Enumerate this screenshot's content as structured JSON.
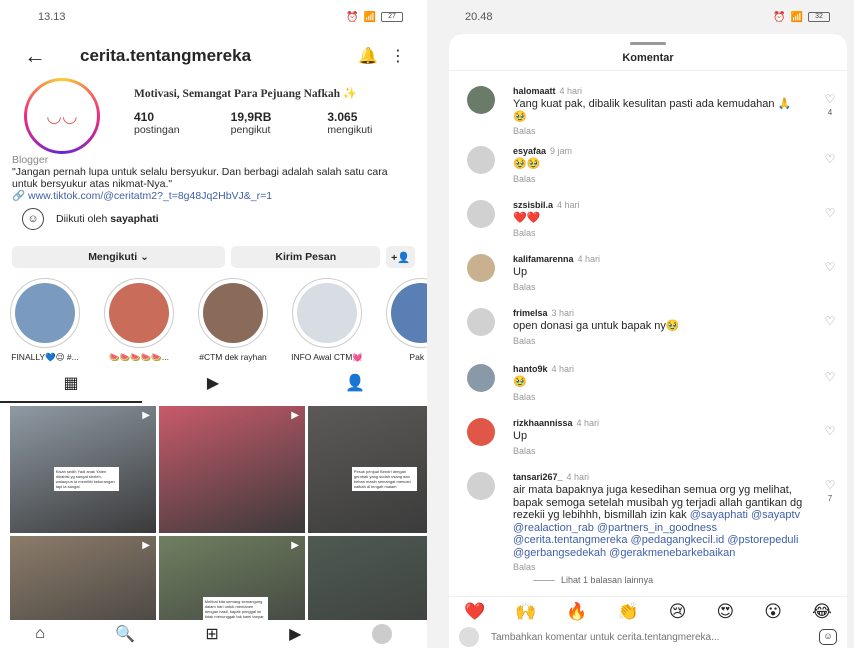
{
  "left": {
    "status": {
      "time": "13.13",
      "battery": "27"
    },
    "header": {
      "username": "cerita.tentangmereka",
      "back_icon": "arrow-left-icon",
      "notify_icon": "bell-icon",
      "menu_icon": "more-vertical-icon"
    },
    "profile": {
      "display_name": "Motivasi, Semangat Para Pejuang Nafkah ✨",
      "stats": [
        {
          "num": "410",
          "label": "postingan"
        },
        {
          "num": "19,9RB",
          "label": "pengikut"
        },
        {
          "num": "3.065",
          "label": "mengikuti"
        }
      ],
      "category": "Blogger",
      "bio": "\"Jangan pernah lupa untuk selalu bersyukur. Dan berbagi adalah salah satu cara untuk bersyukur atas nikmat-Nya.\"",
      "link": "www.tiktok.com/@ceritatm2?_t=8g48Jq2HbVJ&_r=1",
      "followed_by_prefix": "Diikuti oleh ",
      "followed_by_user": "sayaphati"
    },
    "buttons": {
      "following": "Mengikuti ⌄",
      "message": "Kirim Pesan",
      "add_person": "+👤"
    },
    "highlights": [
      {
        "label": "FINALLY💙😉 #...",
        "color": "#7a9bbf"
      },
      {
        "label": "🍉🍉🍉🍉🍉...",
        "color": "#c96d5a"
      },
      {
        "label": "#CTM dek rayhan",
        "color": "#8a6a58"
      },
      {
        "label": "INFO Awal CTM💓",
        "color": "#d8dde4"
      },
      {
        "label": "Pak D",
        "color": "#5a7fb5"
      }
    ],
    "photos": [
      {
        "color": "#8f9aa4",
        "caption": "Kisah sedih Yadi anak Yatim dihabisi yg sangat sholeh, walaupun ia memiliki kekurangan tapi ia sangat"
      },
      {
        "color": "#c85a6a",
        "caption": ""
      },
      {
        "color": "#5c5a58",
        "caption": "Pesuk penjual Bendri dengan gerobak yang sudah usang dan beban masih semangat mencari nafkah di tengah malam"
      },
      {
        "color": "#8c7c6a",
        "caption": ""
      },
      {
        "color": "#6f8060",
        "caption": "Melihat kita semang semangung dalam hari untuk memanen dengan hasil, bapak penggal ini tidak menunggak tak kami tanyar, apa kami semua bersemangat"
      },
      {
        "color": "#4e5a52",
        "caption": ""
      }
    ]
  },
  "right": {
    "status": {
      "time": "20.48",
      "battery": "32"
    },
    "sheet_title": "Komentar",
    "comments": [
      {
        "user": "halomaatt",
        "time": "4 hari",
        "text": "Yang kuat pak, dibalik kesulitan pasti ada kemudahan 🙏🥹",
        "likes": "4",
        "avatar": "#6a7b6a",
        "mentions": ""
      },
      {
        "user": "esyafaa",
        "time": "9 jam",
        "text": "🥹🥹",
        "likes": "",
        "avatar": "#d1d1d1",
        "mentions": ""
      },
      {
        "user": "szsisbil.a",
        "time": "4 hari",
        "text": "❤️❤️",
        "likes": "",
        "avatar": "#d1d1d1",
        "mentions": ""
      },
      {
        "user": "kalifamarenna",
        "time": "4 hari",
        "text": "Up",
        "likes": "",
        "avatar": "#c9b08e",
        "mentions": ""
      },
      {
        "user": "frimelsa",
        "time": "3 hari",
        "text": "open donasi ga untuk bapak ny🥹",
        "likes": "",
        "avatar": "#d1d1d1",
        "mentions": ""
      },
      {
        "user": "hanto9k",
        "time": "4 hari",
        "text": "🥹",
        "likes": "",
        "avatar": "#8a99a8",
        "mentions": ""
      },
      {
        "user": "rizkhaannissa",
        "time": "4 hari",
        "text": "Up",
        "likes": "",
        "avatar": "#e0574a",
        "mentions": ""
      },
      {
        "user": "tansari267_",
        "time": "4 hari",
        "text": "air mata bapaknya juga kesedihan semua org yg melihat, bapak semoga setelah musibah yg terjadi allah gantikan dg rezekii yg lebihhh, bismillah izin kak",
        "likes": "7",
        "avatar": "#d1d1d1",
        "mentions": "@sayaphati @sayaptv @realaction_rab @partners_in_goodness @cerita.tentangmereka @pedagangkecil.id @pstorepeduli @gerbangsedekah @gerakmenebarkebaikan"
      }
    ],
    "reply_label": "Balas",
    "more_replies": "Lihat 1 balasan lainnya",
    "emojis": [
      "❤️",
      "🙌",
      "🔥",
      "👏",
      "😢",
      "😍",
      "😮",
      "😂"
    ],
    "comment_placeholder": "Tambahkan komentar untuk cerita.tentangmereka..."
  }
}
